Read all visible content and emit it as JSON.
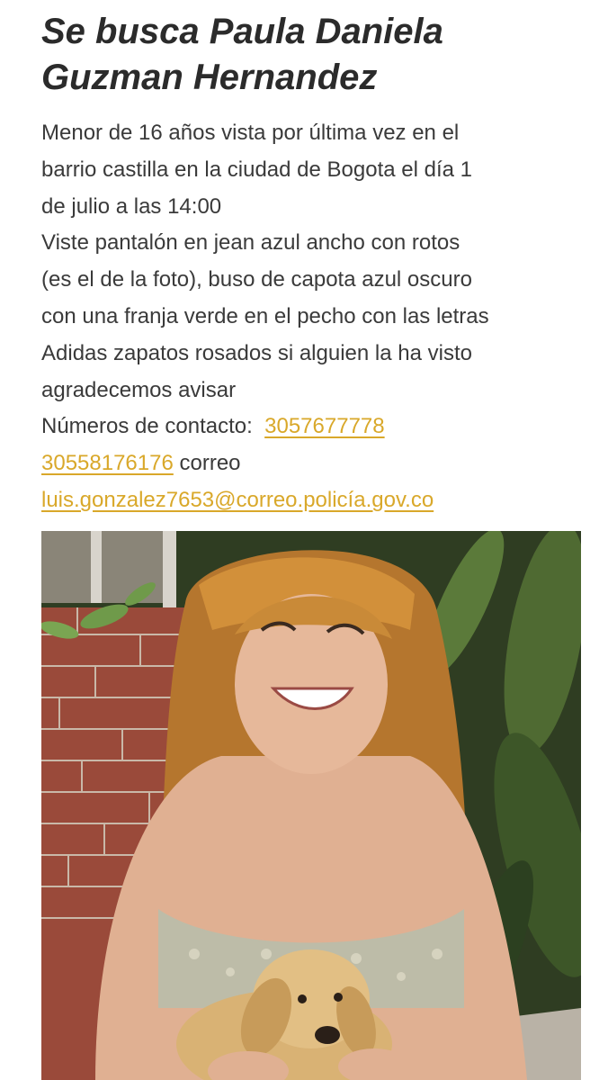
{
  "poster": {
    "title_line1": "Se busca Paula Daniela",
    "title_line2": "Guzman Hernandez",
    "lines": [
      "Menor de 16 años vista por última vez en el",
      "barrio castilla en la ciudad de Bogota el día 1",
      "de julio a las 14:00",
      "Viste pantalón en jean azul ancho con rotos",
      "(es el de la foto), buso de capota azul oscuro",
      "con una franja verde en el pecho con las letras",
      "Adidas zapatos rosados si alguien la ha visto",
      "agradecemos avisar"
    ],
    "contact_label": "Números de contacto:",
    "phone1": "3057677778",
    "phone2": "30558176176",
    "email_label": "correo",
    "email": "luis.gonzalez7653@correo.policía.gov.co"
  },
  "colors": {
    "link": "#d9a82a",
    "text": "#3a3a3a"
  }
}
